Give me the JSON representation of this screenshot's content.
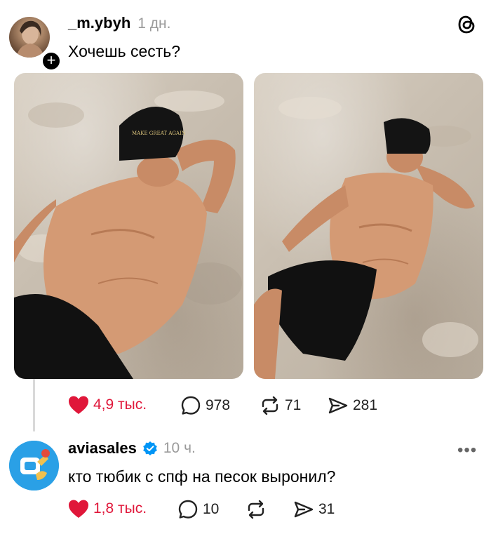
{
  "post1": {
    "username": "_m.ybyh",
    "time": "1 дн.",
    "text": "Хочешь сесть?",
    "likes": "4,9 тыс.",
    "comments": "978",
    "reposts": "71",
    "shares": "281",
    "cap_text": "MAKE GREAT AGAIN"
  },
  "post2": {
    "username": "aviasales",
    "time": "10 ч.",
    "text": "кто тюбик с спф на песок выронил?",
    "likes": "1,8 тыс.",
    "comments": "10",
    "shares": "31"
  },
  "colors": {
    "like_red": "#e0173a",
    "verified_blue": "#0095f6",
    "thread_line": "#d9d9d9",
    "aviasales_blue": "#2aa0e6"
  },
  "icons": [
    "threads-logo-icon",
    "plus-icon",
    "heart-icon",
    "comment-icon",
    "repost-icon",
    "share-icon",
    "verified-icon",
    "more-icon"
  ]
}
